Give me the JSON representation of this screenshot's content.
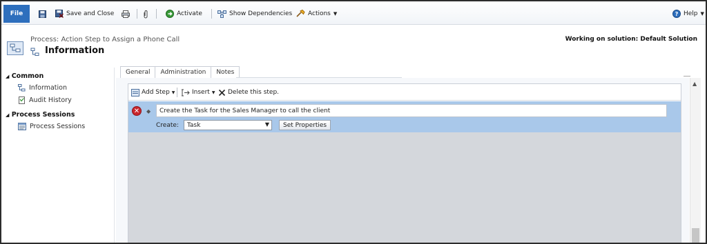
{
  "toolbar": {
    "file_label": "File",
    "save_and_close": "Save and Close",
    "activate": "Activate",
    "show_dependencies": "Show Dependencies",
    "actions": "Actions",
    "help": "Help"
  },
  "header": {
    "subtitle": "Process: Action Step to Assign a Phone Call",
    "title": "Information",
    "solution": "Working on solution: Default Solution"
  },
  "sidebar": {
    "common_label": "Common",
    "items": [
      {
        "label": "Information",
        "icon": "process-icon"
      },
      {
        "label": "Audit History",
        "icon": "audit-history-icon"
      }
    ],
    "process_sessions_label": "Process Sessions",
    "process_sessions_item": "Process Sessions"
  },
  "tabs": [
    "General",
    "Administration",
    "Notes"
  ],
  "designer": {
    "add_step": "Add Step",
    "insert": "Insert",
    "delete_step": "Delete this step.",
    "step_description": "Create the Task for the Sales Manager to call the client",
    "create_label": "Create:",
    "create_value": "Task",
    "set_properties": "Set Properties"
  },
  "colors": {
    "accent": "#2e6fbd",
    "step_highlight": "#a9c8ea",
    "error": "#c9262c"
  }
}
